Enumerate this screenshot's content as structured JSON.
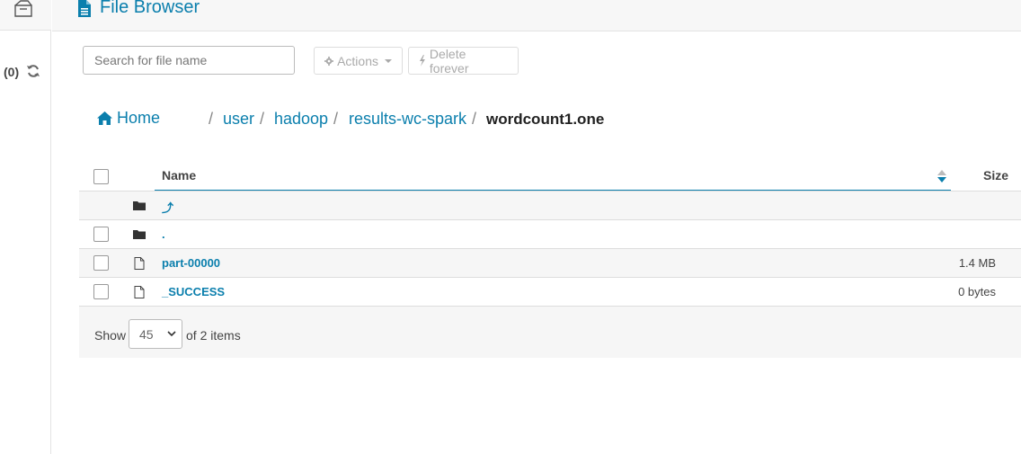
{
  "rail": {
    "count": "(0)"
  },
  "header": {
    "title": "File Browser"
  },
  "toolbar": {
    "search_placeholder": "Search for file name",
    "actions_label": "Actions",
    "delete_label": "Delete forever"
  },
  "breadcrumb": {
    "home": "Home",
    "items": [
      "user",
      "hadoop",
      "results-wc-spark"
    ],
    "current": "wordcount1.one",
    "separator": "/"
  },
  "table": {
    "columns": {
      "name": "Name",
      "size": "Size"
    },
    "rows": [
      {
        "type": "folder",
        "name": "⤴",
        "size": "",
        "checkbox": false
      },
      {
        "type": "folder",
        "name": ".",
        "size": "",
        "checkbox": true
      },
      {
        "type": "file",
        "name": "part-00000",
        "size": "1.4 MB",
        "checkbox": true
      },
      {
        "type": "file",
        "name": "_SUCCESS",
        "size": "0 bytes",
        "checkbox": true
      }
    ]
  },
  "footer": {
    "show_label": "Show",
    "page_size": "45",
    "of_items": "of 2 items"
  },
  "colors": {
    "accent": "#0B7FAD",
    "muted": "#aaaaaa"
  }
}
